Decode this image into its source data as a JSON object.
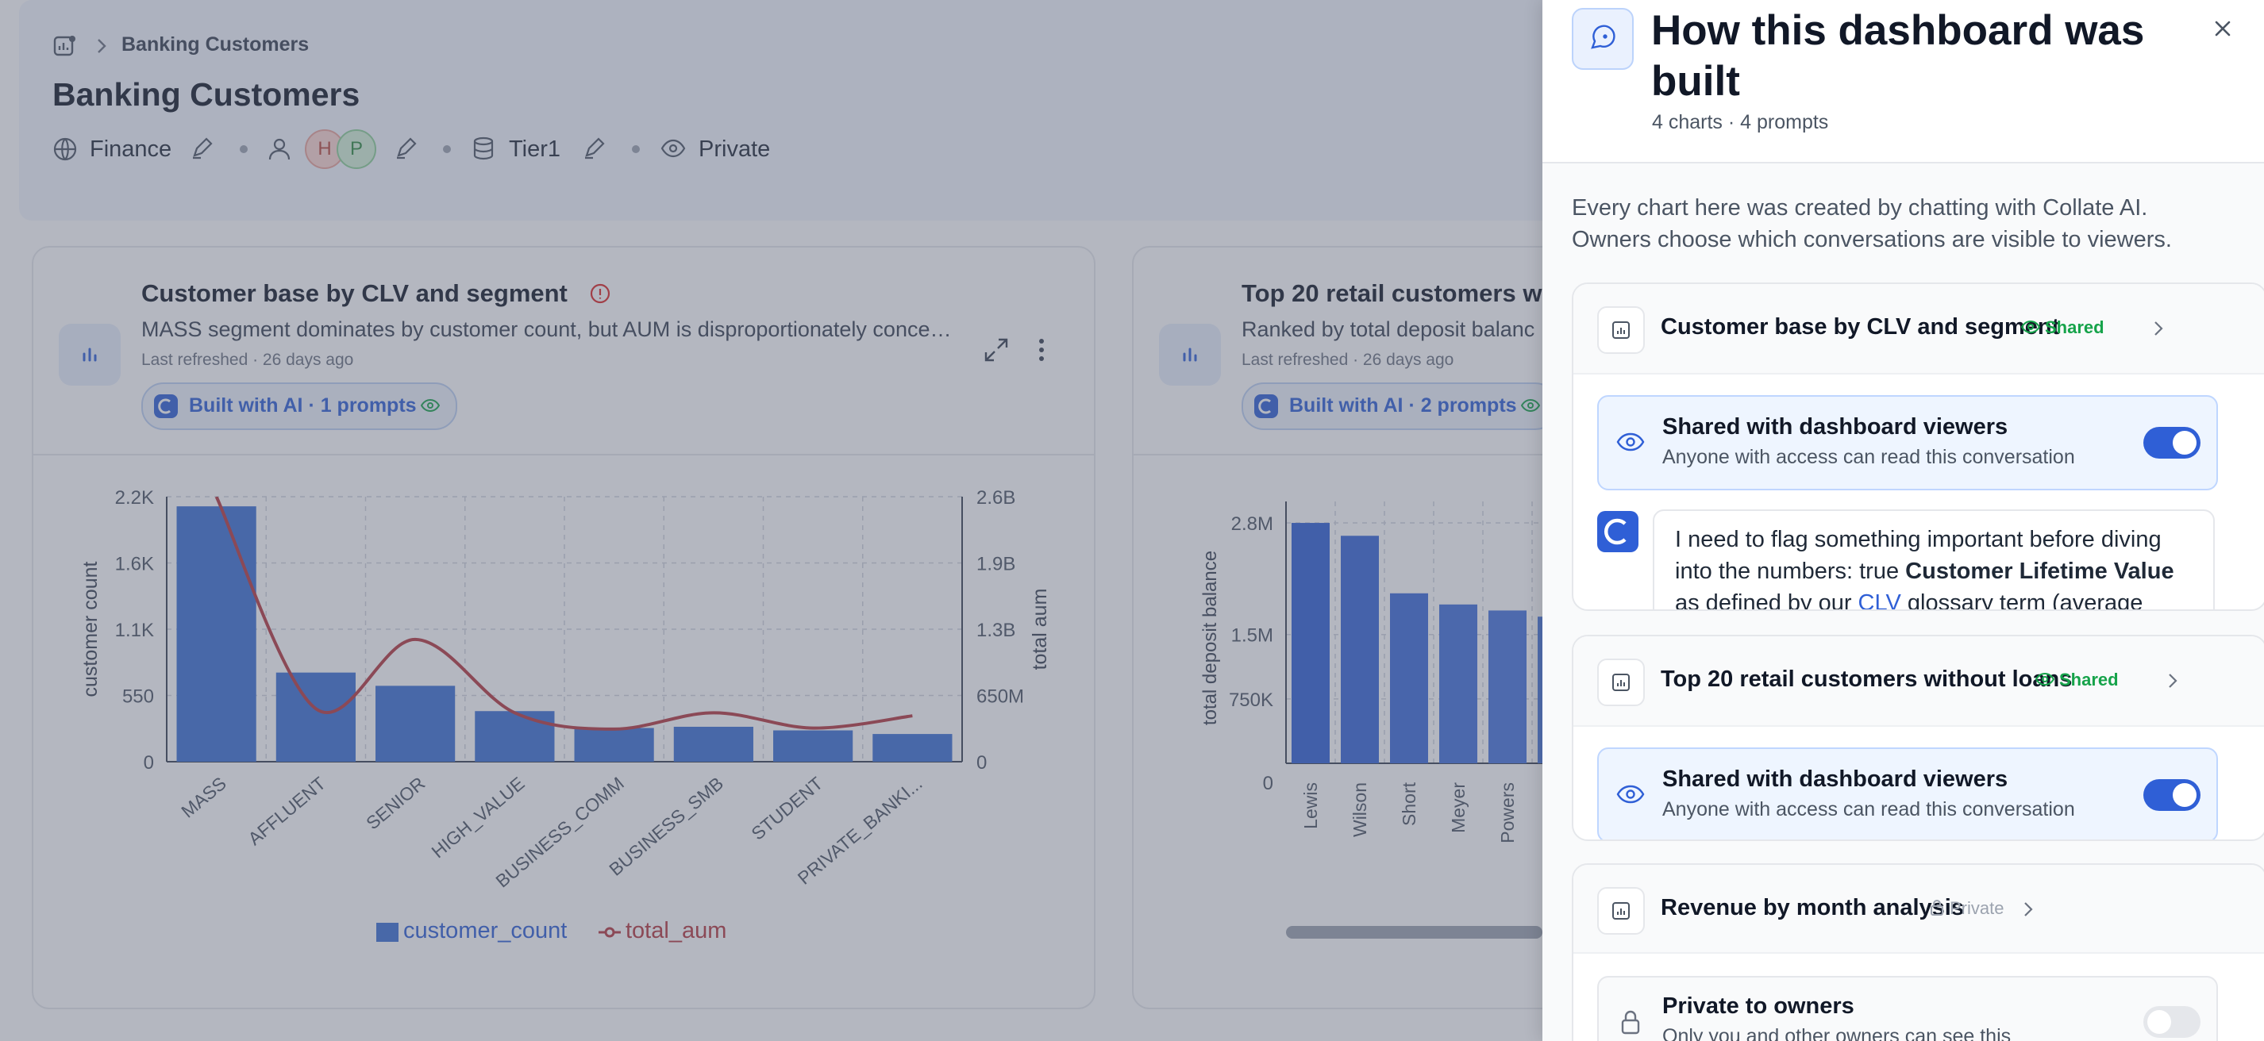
{
  "breadcrumb": {
    "current": "Banking Customers"
  },
  "dashboard": {
    "title": "Banking Customers",
    "domain": "Finance",
    "owners": [
      "H",
      "P"
    ],
    "tier": "Tier1",
    "visibility": "Private"
  },
  "charts": [
    {
      "title": "Customer base by CLV and segment",
      "subtitle": "MASS segment dominates by customer count, but AUM is disproportionately conce…",
      "refreshed": "Last refreshed · 26 days ago",
      "ai_badge": "Built with AI · 1 prompts"
    },
    {
      "title": "Top 20 retail customers w",
      "subtitle": "Ranked by total deposit balanc",
      "refreshed": "Last refreshed · 26 days ago",
      "ai_badge": "Built with AI · 2 prompts"
    }
  ],
  "chart_data": [
    {
      "type": "bar",
      "categories": [
        "MASS",
        "AFFLUENT",
        "SENIOR",
        "HIGH_VALUE",
        "BUSINESS_COMM",
        "BUSINESS_SMB",
        "STUDENT",
        "PRIVATE_BANKI..."
      ],
      "series": [
        {
          "name": "customer_count",
          "type": "bar",
          "axis": "left",
          "values": [
            2120,
            740,
            630,
            420,
            280,
            290,
            260,
            230
          ]
        },
        {
          "name": "total_aum",
          "type": "line",
          "axis": "right",
          "values": [
            2600000000,
            520000000,
            1200000000,
            480000000,
            320000000,
            480000000,
            330000000,
            450000000
          ]
        }
      ],
      "ylabel": "customer count",
      "y2label": "total aum",
      "yticks": [
        "0",
        "550",
        "1.1K",
        "1.6K",
        "2.2K"
      ],
      "y2ticks": [
        "0",
        "650M",
        "1.3B",
        "1.9B",
        "2.6B"
      ],
      "ylim": [
        0,
        2200
      ],
      "y2lim": [
        0,
        2600000000
      ],
      "grid": true,
      "legend": "bottom",
      "colors": {
        "customer_count": "#3b6fd4",
        "total_aum": "#b4383e"
      }
    },
    {
      "type": "bar",
      "categories": [
        "Lewis",
        "Wilson",
        "Short",
        "Meyer",
        "Powers"
      ],
      "series": [
        {
          "name": "total deposit balance",
          "values": [
            2800000,
            2650000,
            1980000,
            1850000,
            1780000
          ]
        }
      ],
      "ylabel": "total deposit balance",
      "yticks": [
        "0",
        "750K",
        "1.5M",
        "2.8M"
      ],
      "ytick_values": [
        0,
        750000,
        1500000,
        2800000
      ],
      "ylim": [
        0,
        3050000
      ],
      "grid": true
    }
  ],
  "panel": {
    "title_line1": "How this dashboard was",
    "title_line2": "built",
    "stats": "4 charts · 4 prompts",
    "intro_line1": "Every chart here was created by chatting with Collate AI.",
    "intro_line2": "Owners choose which conversations are visible to viewers.",
    "sections": [
      {
        "title": "Customer base by CLV and segment",
        "status": "Shared",
        "share_title": "Shared with dashboard viewers",
        "share_desc": "Anyone with access can read this conversation",
        "message_line1": "I need to flag something important before diving",
        "message_line2_a": "into the numbers: true ",
        "message_line2_b": "Customer Lifetime Value",
        "message_line3_a": "as defined by our ",
        "message_line3_link": "CLV",
        "message_line3_b": " glossary term (average"
      },
      {
        "title": "Top 20 retail customers without loans",
        "status": "Shared",
        "share_title": "Shared with dashboard viewers",
        "share_desc": "Anyone with access can read this conversation"
      },
      {
        "title": "Revenue by month analysis",
        "status": "Private",
        "share_title": "Private to owners",
        "share_desc": "Only you and other owners can see this"
      }
    ]
  },
  "colors": {
    "accent": "#2f5fd6",
    "danger": "#b4383e",
    "shared": "#16a34a"
  }
}
